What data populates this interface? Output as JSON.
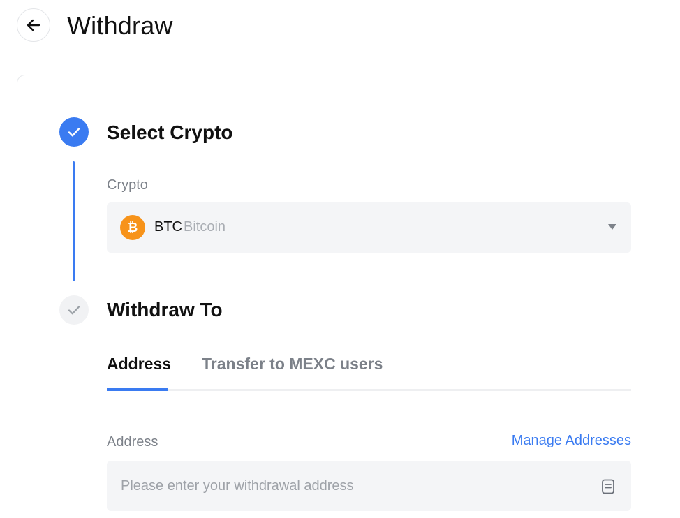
{
  "header": {
    "title": "Withdraw",
    "back_icon": "arrow-left-icon"
  },
  "steps": [
    {
      "title": "Select Crypto",
      "status": "complete",
      "icon": "check-icon",
      "field_label": "Crypto",
      "selected_coin": {
        "symbol": "BTC",
        "name": "Bitcoin",
        "icon": "bitcoin-icon",
        "icon_color": "#f7931a"
      }
    },
    {
      "title": "Withdraw To",
      "status": "pending",
      "icon": "check-icon",
      "tabs": [
        {
          "label": "Address",
          "active": true
        },
        {
          "label": "Transfer to MEXC users",
          "active": false
        }
      ],
      "address_label": "Address",
      "manage_link": "Manage Addresses",
      "address_placeholder": "Please enter your withdrawal address",
      "address_value": "",
      "address_book_icon": "address-book-icon"
    }
  ],
  "colors": {
    "accent": "#3a7bf1",
    "muted_text": "#7c8189",
    "field_bg": "#f4f5f7"
  }
}
